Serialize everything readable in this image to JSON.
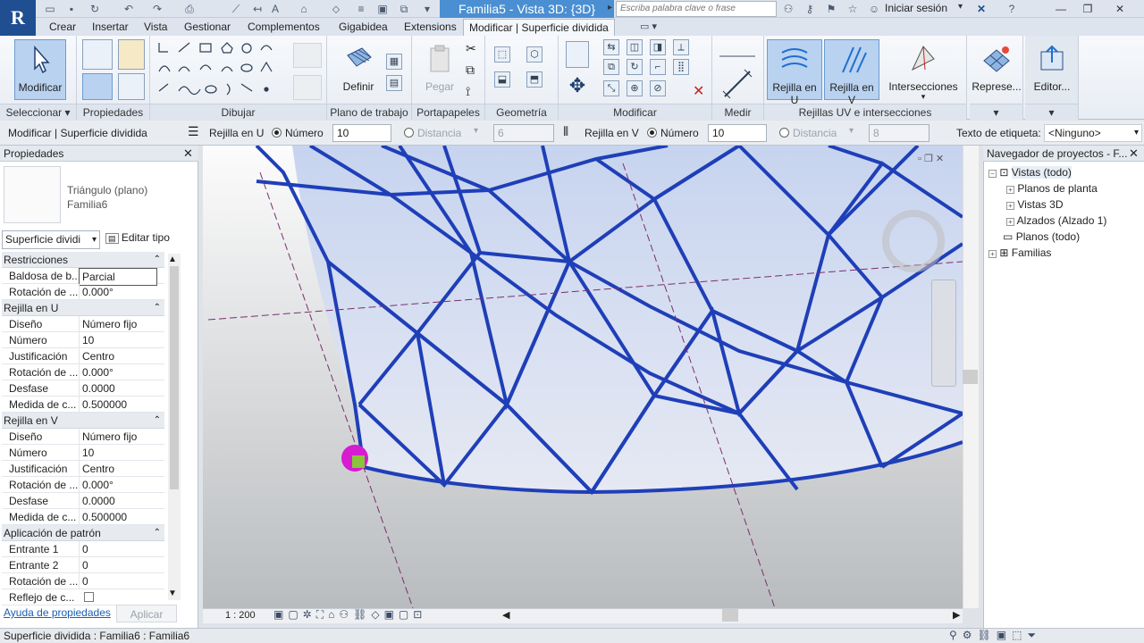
{
  "app": {
    "logo": "R",
    "doc_title": "Familia5 - Vista 3D: {3D}",
    "search_placeholder": "Escriba palabra clave o frase",
    "sign_in": "Iniciar sesión"
  },
  "tabs": [
    "Crear",
    "Insertar",
    "Vista",
    "Gestionar",
    "Complementos",
    "Gigabidea",
    "Extensions",
    "Modificar | Superficie dividida"
  ],
  "ribbon": {
    "modify_label": "Modificar",
    "define_label": "Definir",
    "paste_label": "Pegar",
    "grid_u_label": "Rejilla en U",
    "grid_v_label": "Rejilla en V",
    "intersections_label": "Intersecciones",
    "represent_label": "Represe...",
    "editor_label": "Editor...",
    "panels": {
      "select": "Seleccionar",
      "properties": "Propiedades",
      "draw": "Dibujar",
      "workplane": "Plano de trabajo",
      "clipboard": "Portapapeles",
      "geometry": "Geometría",
      "modify": "Modificar",
      "measure": "Medir",
      "uv_grids": "Rejillas UV e intersecciones"
    }
  },
  "options": {
    "context": "Modificar | Superficie dividida",
    "u_grid": "Rejilla en U",
    "u_number_label": "Número",
    "u_number": "10",
    "u_distance_label": "Distancia",
    "u_distance": "6",
    "v_grid": "Rejilla en V",
    "v_number_label": "Número",
    "v_number": "10",
    "v_distance_label": "Distancia",
    "v_distance": "8",
    "tag_label": "Texto de etiqueta:",
    "tag_value": "<Ninguno>"
  },
  "properties": {
    "title": "Propiedades",
    "type_line1": "Triángulo (plano)",
    "type_line2": "Familia6",
    "selector": "Superficie dividi",
    "edit_type": "Editar tipo",
    "sections": [
      {
        "title": "Restricciones",
        "rows": [
          {
            "k": "Baldosa de b...",
            "v": "Parcial"
          },
          {
            "k": "Rotación de ...",
            "v": "0.000°"
          }
        ]
      },
      {
        "title": "Rejilla en U",
        "rows": [
          {
            "k": "Diseño",
            "v": "Número fijo"
          },
          {
            "k": "Número",
            "v": "10"
          },
          {
            "k": "Justificación",
            "v": "Centro"
          },
          {
            "k": "Rotación de ...",
            "v": "0.000°"
          },
          {
            "k": "Desfase",
            "v": "0.0000"
          },
          {
            "k": "Medida de c...",
            "v": "0.500000"
          }
        ]
      },
      {
        "title": "Rejilla en V",
        "rows": [
          {
            "k": "Diseño",
            "v": "Número fijo"
          },
          {
            "k": "Número",
            "v": "10"
          },
          {
            "k": "Justificación",
            "v": "Centro"
          },
          {
            "k": "Rotación de ...",
            "v": "0.000°"
          },
          {
            "k": "Desfase",
            "v": "0.0000"
          },
          {
            "k": "Medida de c...",
            "v": "0.500000"
          }
        ]
      },
      {
        "title": "Aplicación de patrón",
        "rows": [
          {
            "k": "Entrante 1",
            "v": "0"
          },
          {
            "k": "Entrante 2",
            "v": "0"
          },
          {
            "k": "Rotación de ...",
            "v": "0"
          },
          {
            "k": "Reflejo de c...",
            "v": ""
          }
        ]
      }
    ],
    "help_link": "Ayuda de propiedades",
    "apply": "Aplicar"
  },
  "viewport": {
    "scale": "1 : 200",
    "mesh_color": "#1f3fb8"
  },
  "browser": {
    "title": "Navegador de proyectos - F...",
    "nodes": [
      {
        "label": "Vistas (todo)"
      },
      {
        "label": "Planos de planta"
      },
      {
        "label": "Vistas 3D"
      },
      {
        "label": "Alzados (Alzado 1)"
      },
      {
        "label": "Planos (todo)"
      },
      {
        "label": "Familias"
      }
    ]
  },
  "status": "Superficie dividida : Familia6 : Familia6"
}
